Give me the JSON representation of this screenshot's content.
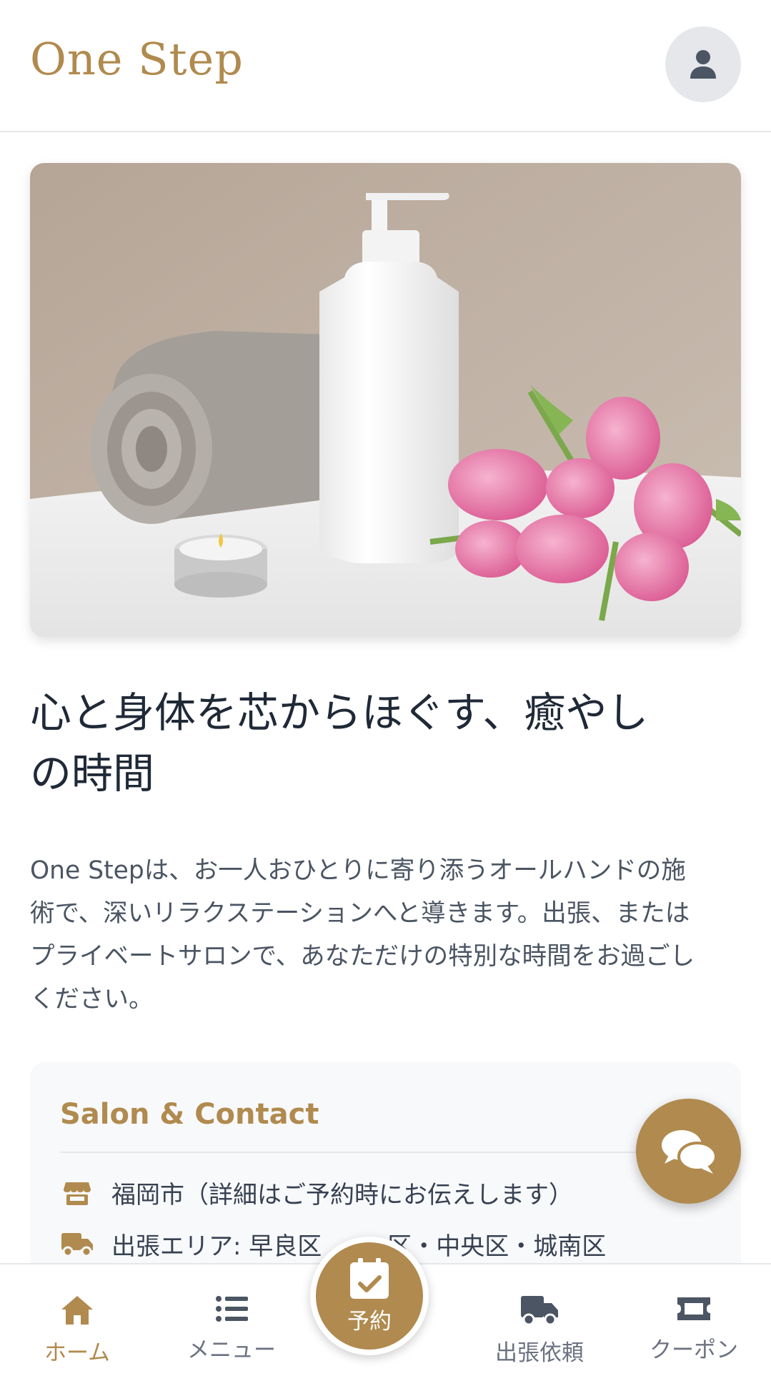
{
  "header": {
    "brand": "One Step",
    "profile_icon": "user-icon"
  },
  "hero": {
    "image_subject": "spa-towel-bottle-candle-tulips"
  },
  "main": {
    "headline_line1": "心と身体を芯からほぐす、癒やし",
    "headline_line2": "の時間",
    "intro_lines": [
      "One Stepは、お一人おひとりに寄り添うオールハンドの施",
      "術で、深いリラクステーションへと導きます。出張、または",
      "プライベートサロンで、あなただけの特別な時間をお過ごし",
      "ください。"
    ]
  },
  "contact": {
    "title": "Salon & Contact",
    "location": "福岡市（詳細はご予約時にお伝えします）",
    "area_prefix": "出張エリア: 早良区",
    "area_suffix": "区・中央区・城南区"
  },
  "chat": {
    "icon": "chat-bubbles-icon"
  },
  "nav": {
    "items": [
      {
        "label": "ホーム",
        "icon": "home-icon"
      },
      {
        "label": "メニュー",
        "icon": "list-icon"
      },
      {
        "label": "予約",
        "icon": "calendar-check-icon"
      },
      {
        "label": "出張依頼",
        "icon": "truck-icon"
      },
      {
        "label": "クーポン",
        "icon": "ticket-icon"
      }
    ]
  },
  "colors": {
    "accent": "#b08a4e",
    "text_dark": "#1f2937",
    "text_muted": "#4b5563",
    "nav_inactive": "#6b7280",
    "card_bg": "#f8f9fb"
  }
}
